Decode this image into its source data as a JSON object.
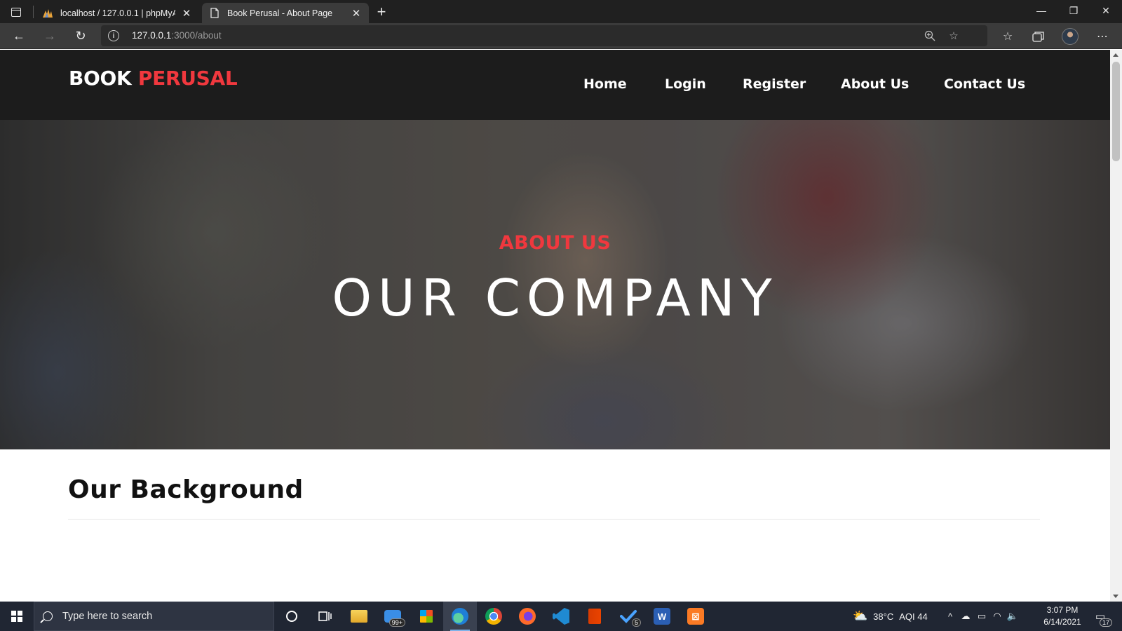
{
  "browser": {
    "tabs": [
      {
        "title": "localhost / 127.0.0.1 | phpMyAdmin",
        "active": false,
        "icon": "phpmyadmin-icon"
      },
      {
        "title": "Book Perusal - About Page",
        "active": true,
        "icon": "page-icon"
      }
    ],
    "address": {
      "host": "127.0.0.1",
      "path": ":3000/about"
    },
    "window_controls": {
      "minimize": "—",
      "restore": "❐",
      "close": "✕"
    }
  },
  "site": {
    "brand": {
      "first": "BOOK",
      "second": "PERUSAL"
    },
    "nav": [
      "Home",
      "Login",
      "Register",
      "About Us",
      "Contact Us"
    ],
    "hero": {
      "subtitle": "ABOUT US",
      "title": "OUR COMPANY"
    },
    "section": {
      "title": "Our Background"
    },
    "colors": {
      "accent": "#f0383e",
      "header_bg": "#1c1c1c"
    }
  },
  "taskbar": {
    "search_placeholder": "Type here to search",
    "apps": [
      {
        "name": "cortana-icon"
      },
      {
        "name": "task-view-icon"
      },
      {
        "name": "file-explorer-icon"
      },
      {
        "name": "mail-icon",
        "badge": "99+"
      },
      {
        "name": "store-icon"
      },
      {
        "name": "edge-icon",
        "active": true
      },
      {
        "name": "chrome-icon"
      },
      {
        "name": "firefox-icon"
      },
      {
        "name": "vscode-icon"
      },
      {
        "name": "office-icon"
      },
      {
        "name": "todo-icon",
        "badge": "5"
      },
      {
        "name": "word-icon"
      },
      {
        "name": "xampp-icon"
      }
    ],
    "weather": {
      "temp": "38°C",
      "aqi": "AQI 44"
    },
    "time": "3:07 PM",
    "date": "6/14/2021",
    "notifications": "17"
  }
}
